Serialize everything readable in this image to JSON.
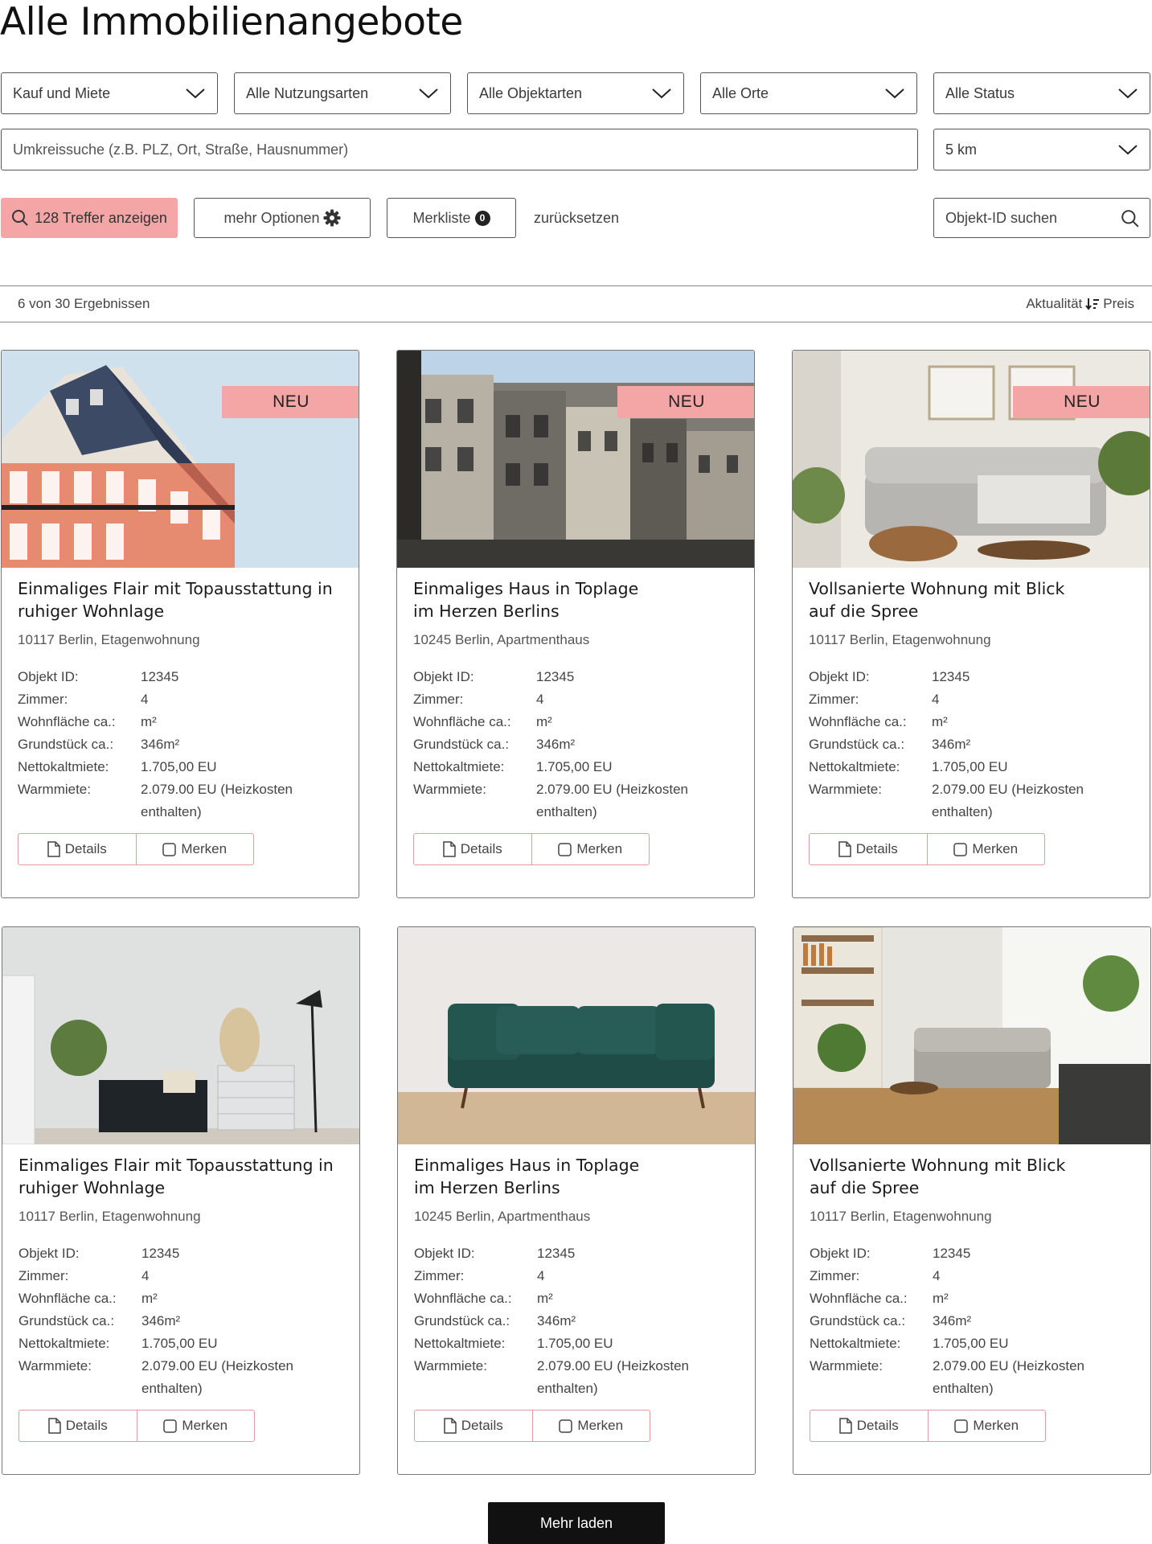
{
  "page": {
    "title": "Alle Immobilienangebote"
  },
  "filters": {
    "kauf_miete": "Kauf und Miete",
    "nutzungsarten": "Alle Nutzungsarten",
    "objektarten": "Alle Objektarten",
    "orte": "Alle Orte",
    "status": "Alle Status",
    "umkreis_placeholder": "Umkreissuche (z.B. PLZ, Ort, Straße, Hausnummer)",
    "radius": "5 km"
  },
  "toolbar": {
    "search_label": "128 Treffer anzeigen",
    "more_options_label": "mehr Optionen",
    "watchlist_label": "Merkliste",
    "watchlist_count": "0",
    "reset_label": "zurücksetzen",
    "objekt_id_placeholder": "Objekt-ID suchen"
  },
  "results": {
    "count_text": "6 von 30 Ergebnissen",
    "sort_primary": "Aktualität",
    "sort_secondary": "Preis"
  },
  "labels": {
    "objekt_id": "Objekt ID:",
    "zimmer": "Zimmer:",
    "wohnflaeche": "Wohnfläche ca.:",
    "grundstueck": "Grundstück ca.:",
    "nettokaltmiete": "Nettokaltmiete:",
    "warmmiete": "Warmmiete:",
    "details": "Details",
    "merken": "Merken",
    "neu": "NEU"
  },
  "listings": [
    {
      "title": "Einmaliges Flair mit Topausstattung in ruhiger Wohnlage",
      "location": "10117 Berlin, Etagenwohnung",
      "objekt_id": "12345",
      "zimmer": "4",
      "wohnflaeche": "m²",
      "grundstueck": "346m²",
      "nettokaltmiete": "1.705,00 EU",
      "warmmiete": "2.079.00 EU (Heizkosten enthalten)",
      "is_new": true,
      "image": "building-facade"
    },
    {
      "title": "Einmaliges Haus in Toplage im Herzen Berlins",
      "location": "10245 Berlin, Apartmenthaus",
      "objekt_id": "12345",
      "zimmer": "4",
      "wohnflaeche": "m²",
      "grundstueck": "346m²",
      "nettokaltmiete": "1.705,00 EU",
      "warmmiete": "2.079.00 EU (Heizkosten enthalten)",
      "is_new": true,
      "image": "townhouses"
    },
    {
      "title": "Vollsanierte Wohnung mit Blick auf die Spree",
      "location": "10117 Berlin, Etagenwohnung",
      "objekt_id": "12345",
      "zimmer": "4",
      "wohnflaeche": "m²",
      "grundstueck": "346m²",
      "nettokaltmiete": "1.705,00 EU",
      "warmmiete": "2.079.00 EU (Heizkosten enthalten)",
      "is_new": true,
      "image": "living-room-sofa"
    },
    {
      "title": "Einmaliges Flair mit Topausstattung in ruhiger Wohnlage",
      "location": "10117 Berlin, Etagenwohnung",
      "objekt_id": "12345",
      "zimmer": "4",
      "wohnflaeche": "m²",
      "grundstueck": "346m²",
      "nettokaltmiete": "1.705,00 EU",
      "warmmiete": "2.079.00 EU (Heizkosten enthalten)",
      "is_new": false,
      "image": "room-lamp-dresser"
    },
    {
      "title": "Einmaliges Haus in Toplage im Herzen Berlins",
      "location": "10245 Berlin, Apartmenthaus",
      "objekt_id": "12345",
      "zimmer": "4",
      "wohnflaeche": "m²",
      "grundstueck": "346m²",
      "nettokaltmiete": "1.705,00 EU",
      "warmmiete": "2.079.00 EU (Heizkosten enthalten)",
      "is_new": false,
      "image": "green-sofa"
    },
    {
      "title": "Vollsanierte Wohnung mit Blick auf die Spree",
      "location": "10117 Berlin, Etagenwohnung",
      "objekt_id": "12345",
      "zimmer": "4",
      "wohnflaeche": "m²",
      "grundstueck": "346m²",
      "nettokaltmiete": "1.705,00 EU",
      "warmmiete": "2.079.00 EU (Heizkosten enthalten)",
      "is_new": false,
      "image": "plant-living-room"
    }
  ],
  "footer": {
    "load_more_label": "Mehr laden"
  },
  "colors": {
    "accent": "#f4a6a6",
    "button_dark": "#111111",
    "border": "#555555"
  }
}
